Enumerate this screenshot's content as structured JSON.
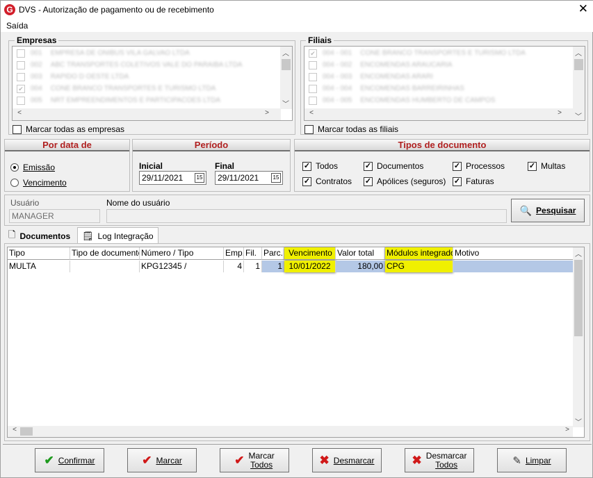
{
  "window": {
    "title": "DVS - Autorização de pagamento ou de recebimento",
    "icon": "G"
  },
  "menu": {
    "items": [
      "Saída"
    ]
  },
  "empresas": {
    "label": "Empresas",
    "items": [
      {
        "code": "001",
        "name": "EMPRESA DE ONIBUS VILA GALVAO LTDA",
        "checked": false
      },
      {
        "code": "002",
        "name": "ABC TRANSPORTES COLETIVOS VALE DO PARAIBA LTDA",
        "checked": false
      },
      {
        "code": "003",
        "name": "RAPIDO D OESTE LTDA",
        "checked": false
      },
      {
        "code": "004",
        "name": "CONE BRANCO TRANSPORTES E TURISMO LTDA",
        "checked": true
      },
      {
        "code": "005",
        "name": "NRT EMPREENDIMENTOS E PARTICIPACOES LTDA",
        "checked": false
      }
    ],
    "select_all_label": "Marcar todas as empresas"
  },
  "filiais": {
    "label": "Filiais",
    "items": [
      {
        "code": "004 - 001",
        "name": "CONE BRANCO TRANSPORTES E TURISMO LTDA",
        "checked": true
      },
      {
        "code": "004 - 002",
        "name": "ENCOMENDAS ARAUCARIA",
        "checked": false
      },
      {
        "code": "004 - 003",
        "name": "ENCOMENDAS ARARI",
        "checked": false
      },
      {
        "code": "004 - 004",
        "name": "ENCOMENDAS BARREIRINHAS",
        "checked": false
      },
      {
        "code": "004 - 005",
        "name": "ENCOMENDAS HUMBERTO DE CAMPOS",
        "checked": false
      }
    ],
    "select_all_label": "Marcar todas as filiais"
  },
  "por_data": {
    "title": "Por data de",
    "options": [
      "Emissão",
      "Vencimento"
    ],
    "selected": "Emissão"
  },
  "periodo": {
    "title": "Período",
    "inicial_label": "Inicial",
    "inicial": "29/11/2021",
    "final_label": "Final",
    "final": "29/11/2021",
    "cal_icon": "15"
  },
  "tipos": {
    "title": "Tipos de documento",
    "items": [
      {
        "label": "Todos",
        "checked": true
      },
      {
        "label": "Documentos",
        "checked": true
      },
      {
        "label": "Processos",
        "checked": true
      },
      {
        "label": "Multas",
        "checked": true
      },
      {
        "label": "Contratos",
        "checked": true
      },
      {
        "label": "Apólices (seguros)",
        "checked": true
      },
      {
        "label": "Faturas",
        "checked": true
      }
    ]
  },
  "usuario": {
    "label": "Usuário",
    "value": "MANAGER",
    "nome_label": "Nome do usuário",
    "nome_value": ""
  },
  "pesquisar": {
    "label": "Pesquisar"
  },
  "tabs": [
    {
      "label": "Documentos",
      "active": false
    },
    {
      "label": "Log Integração",
      "active": true
    }
  ],
  "grid": {
    "columns": [
      "Tipo",
      "Tipo de documento",
      "Número / Tipo",
      "Emp.",
      "Fil.",
      "Parc.",
      "Vencimento",
      "Valor total",
      "Módulos integrados",
      "Motivo"
    ],
    "rows": [
      [
        "MULTA",
        "",
        "KPG12345 /",
        "4",
        "1",
        "1",
        "10/01/2022",
        "180,00",
        "CPG",
        ""
      ]
    ]
  },
  "buttons": {
    "confirmar": "Confirmar",
    "marcar": "Marcar",
    "marcar_todos_1": "Marcar",
    "marcar_todos_2": "Todos",
    "desmarcar": "Desmarcar",
    "desmarcar_todos_1": "Desmarcar",
    "desmarcar_todos_2": "Todos",
    "limpar": "Limpar"
  }
}
